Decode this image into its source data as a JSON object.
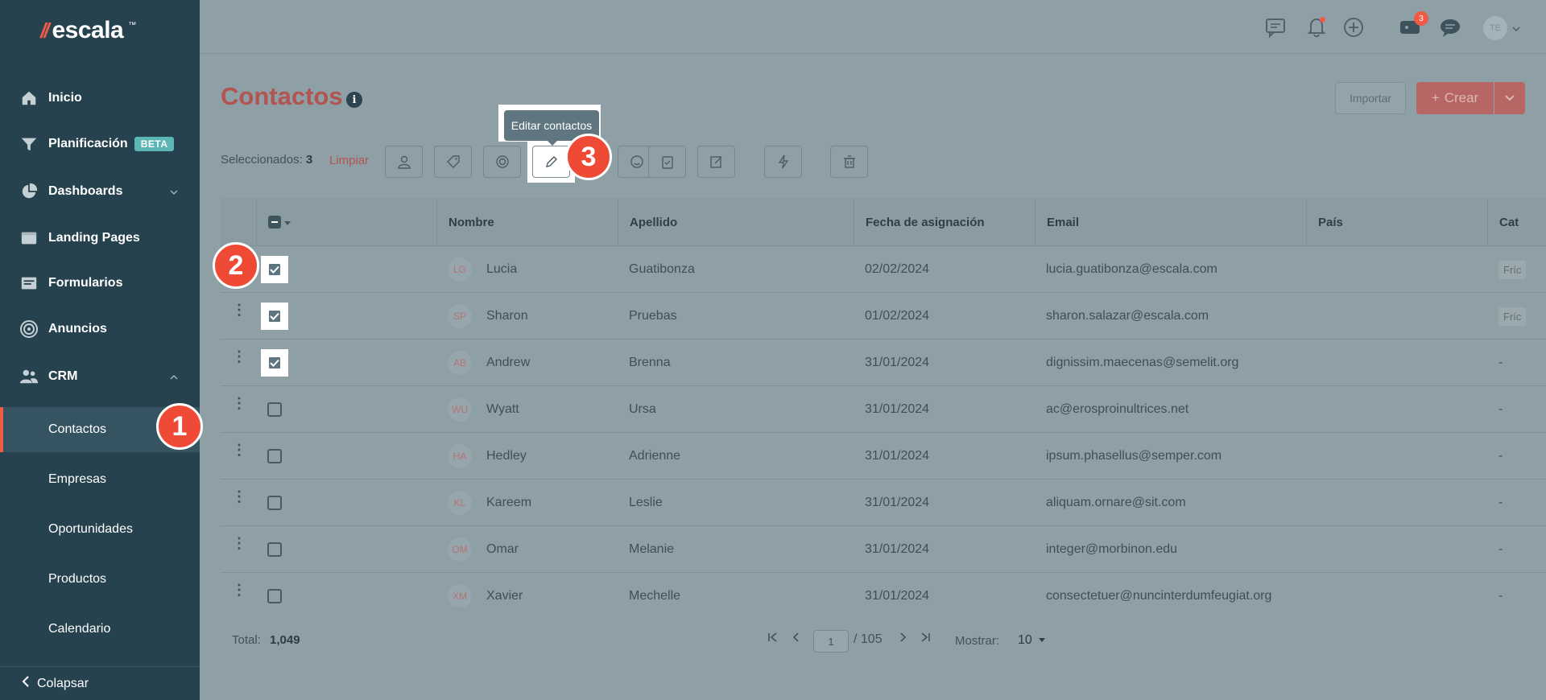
{
  "brand": {
    "name": "escala",
    "mark": "//"
  },
  "sidebar": {
    "items": [
      {
        "label": "Inicio",
        "icon": "home-icon"
      },
      {
        "label": "Planificación",
        "badge": "BETA",
        "icon": "filter-icon"
      },
      {
        "label": "Dashboards",
        "icon": "pie-chart-icon"
      },
      {
        "label": "Landing Pages",
        "icon": "browser-icon"
      },
      {
        "label": "Formularios",
        "icon": "form-icon"
      },
      {
        "label": "Anuncios",
        "icon": "target-icon"
      },
      {
        "label": "CRM",
        "icon": "users-icon"
      }
    ],
    "crm_sub": [
      "Contactos",
      "Empresas",
      "Oportunidades",
      "Productos",
      "Calendario"
    ],
    "collapse_label": "Colapsar"
  },
  "topbar": {
    "notification_count": "3",
    "avatar_initials": "TE"
  },
  "page": {
    "title": "Contactos",
    "import_label": "Importar",
    "create_label": "Crear"
  },
  "selection": {
    "label": "Seleccionados:",
    "count": "3",
    "clear_label": "Limpiar",
    "tooltip": "Editar contactos"
  },
  "steps": [
    "1",
    "2",
    "3"
  ],
  "table": {
    "columns": [
      "Nombre",
      "Apellido",
      "Fecha de asignación",
      "Email",
      "País",
      "Cat"
    ],
    "rows": [
      {
        "initials": "LG",
        "first": "Lucia",
        "last": "Guatibonza",
        "date": "02/02/2024",
        "email": "lucia.guatibonza@escala.com",
        "country": "",
        "cat": "Fríc",
        "checked": true
      },
      {
        "initials": "SP",
        "first": "Sharon",
        "last": "Pruebas",
        "date": "01/02/2024",
        "email": "sharon.salazar@escala.com",
        "country": "",
        "cat": "Fríc",
        "checked": true
      },
      {
        "initials": "AB",
        "first": "Andrew",
        "last": "Brenna",
        "date": "31/01/2024",
        "email": "dignissim.maecenas@semelit.org",
        "country": "",
        "cat": "-",
        "checked": true
      },
      {
        "initials": "WU",
        "first": "Wyatt",
        "last": "Ursa",
        "date": "31/01/2024",
        "email": "ac@erosproinultrices.net",
        "country": "",
        "cat": "-",
        "checked": false
      },
      {
        "initials": "HA",
        "first": "Hedley",
        "last": "Adrienne",
        "date": "31/01/2024",
        "email": "ipsum.phasellus@semper.com",
        "country": "",
        "cat": "-",
        "checked": false
      },
      {
        "initials": "KL",
        "first": "Kareem",
        "last": "Leslie",
        "date": "31/01/2024",
        "email": "aliquam.ornare@sit.com",
        "country": "",
        "cat": "-",
        "checked": false
      },
      {
        "initials": "OM",
        "first": "Omar",
        "last": "Melanie",
        "date": "31/01/2024",
        "email": "integer@morbinon.edu",
        "country": "",
        "cat": "-",
        "checked": false
      },
      {
        "initials": "XM",
        "first": "Xavier",
        "last": "Mechelle",
        "date": "31/01/2024",
        "email": "consectetuer@nuncinterdumfeugiat.org",
        "country": "",
        "cat": "-",
        "checked": false
      }
    ]
  },
  "footer": {
    "total_label": "Total:",
    "total": "1,049",
    "page": "1",
    "pages": "/ 105",
    "show_label": "Mostrar:",
    "show_value": "10"
  }
}
